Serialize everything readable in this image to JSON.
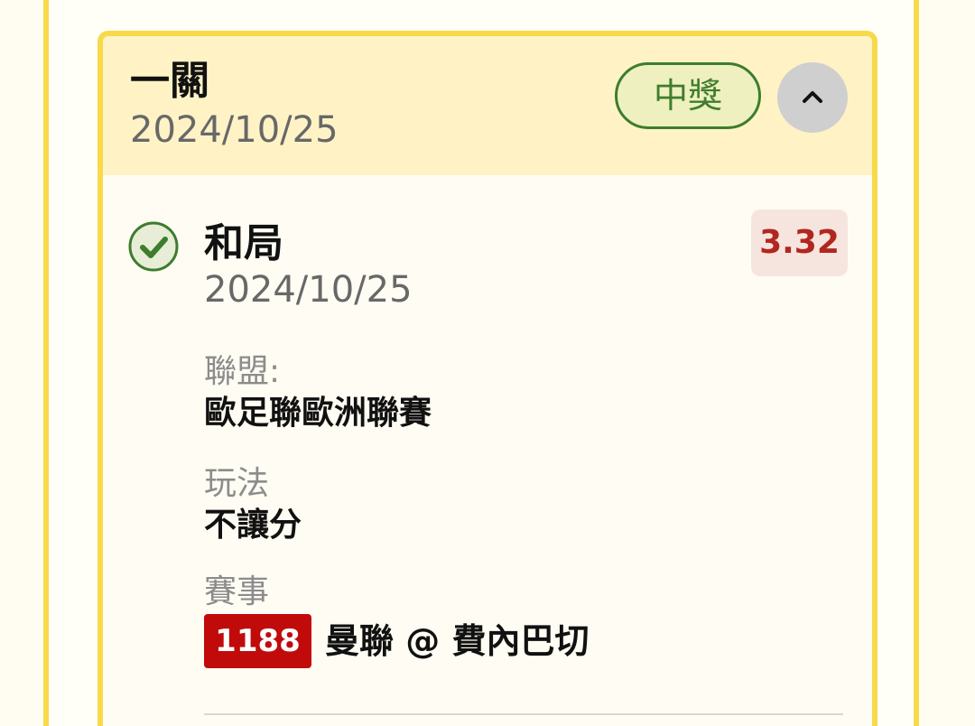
{
  "card": {
    "title": "一關",
    "date": "2024/10/25",
    "status": "中獎",
    "collapse_icon": "chevron-up-icon"
  },
  "selection": {
    "icon": "check-circle-icon",
    "title": "和局",
    "date": "2024/10/25",
    "odds": "3.32",
    "league_label": "聯盟:",
    "league": "歐足聯歐洲聯賽",
    "bet_type_label": "玩法",
    "bet_type": "不讓分",
    "match_label": "賽事",
    "match_number": "1188",
    "match": "曼聯 @ 費內巴切"
  },
  "colors": {
    "card_border": "#f8d94a",
    "header_bg": "#fff3c6",
    "body_bg": "#fffdf3",
    "win_green": "#3f7d2d",
    "odds_red": "#b1271f",
    "match_red": "#c10b0b"
  }
}
